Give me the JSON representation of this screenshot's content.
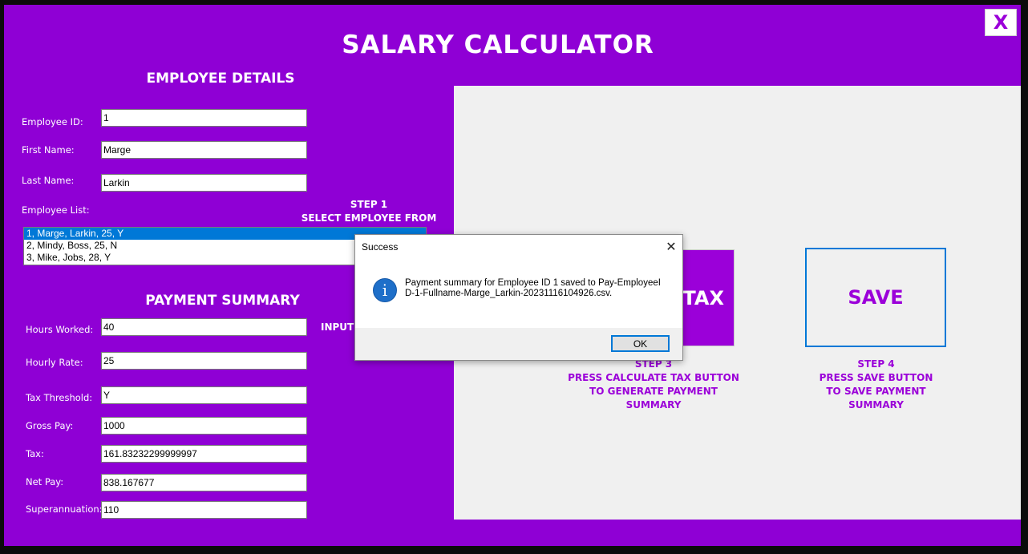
{
  "app": {
    "title": "SALARY CALCULATOR",
    "close_label": "X"
  },
  "employee_details": {
    "heading": "EMPLOYEE DETAILS",
    "fields": [
      {
        "label": "Employee ID:",
        "value": "1"
      },
      {
        "label": "First Name:",
        "value": "Marge"
      },
      {
        "label": "Last Name:",
        "value": "Larkin"
      }
    ],
    "list_label": "Employee List:",
    "list_items": [
      "1, Marge, Larkin, 25, Y",
      "2, Mindy, Boss, 25, N",
      "3, Mike, Jobs, 28, Y"
    ],
    "selected_index": 0
  },
  "steps": {
    "step1_title": "STEP 1",
    "step1_text": "SELECT EMPLOYEE FROM LIST",
    "input_partial": "INPUT",
    "step3_title": "STEP 3",
    "step3_line1": "PRESS CALCULATE TAX BUTTON",
    "step3_line2": "TO GENERATE PAYMENT SUMMARY",
    "step4_title": "STEP 4",
    "step4_line1": "PRESS SAVE BUTTON",
    "step4_line2": "TO SAVE PAYMENT SUMMARY"
  },
  "buttons": {
    "calculate_tax_visible": "TAX",
    "save": "SAVE"
  },
  "payment_summary": {
    "heading": "PAYMENT SUMMARY",
    "fields": [
      {
        "label": "Hours Worked:",
        "value": "40"
      },
      {
        "label": "Hourly Rate:",
        "value": "25"
      },
      {
        "label": "Tax Threshold:",
        "value": "Y"
      },
      {
        "label": "Gross Pay:",
        "value": "1000"
      },
      {
        "label": "Tax:",
        "value": "161.83232299999997"
      },
      {
        "label": "Net Pay:",
        "value": "838.167677"
      },
      {
        "label": "Superannuation:",
        "value": "110"
      }
    ]
  },
  "dialog": {
    "title": "Success",
    "close_glyph": "✕",
    "icon": "info-icon",
    "message": "Payment summary for Employee ID 1 saved to Pay-EmployeeID-1-Fullname-Marge_Larkin-20231116104926.csv.",
    "ok_label": "OK"
  },
  "colors": {
    "background": "#8f00d5",
    "panel": "#f0f0f0",
    "accent_blue": "#0078d7",
    "button_purple": "#9b00d9"
  }
}
